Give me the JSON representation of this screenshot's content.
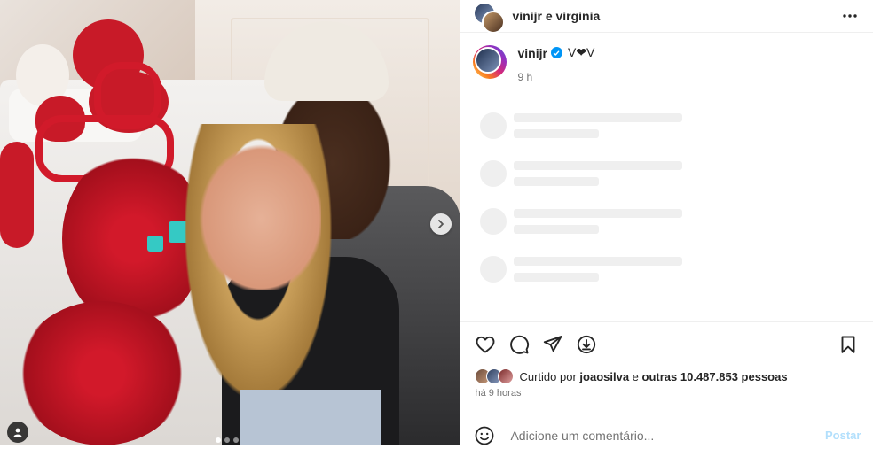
{
  "header": {
    "title": "vinijr e virginia",
    "more_icon": "more-horizontal-icon"
  },
  "caption": {
    "username": "vinijr",
    "text": "V❤V",
    "time": "9 h",
    "verified_color": "#0095f6"
  },
  "carousel": {
    "next_icon": "chevron-right-icon",
    "tag_icon": "user-tag-icon",
    "slide_count": 3,
    "active_slide": 1
  },
  "actions": {
    "like_icon": "heart-icon",
    "comment_icon": "comment-icon",
    "share_icon": "send-icon",
    "download_icon": "download-icon",
    "save_icon": "bookmark-icon"
  },
  "likes": {
    "prefix": "Curtido por",
    "user": "joaosilva",
    "middle": "e",
    "others": "outras 10.487.853 pessoas"
  },
  "time_ago": "há 9 horas",
  "comment": {
    "placeholder": "Adicione um comentário...",
    "post_label": "Postar"
  },
  "colors": {
    "accent": "#0095f6",
    "heart": "#ed4956",
    "post_disabled": "#b2dffc"
  }
}
